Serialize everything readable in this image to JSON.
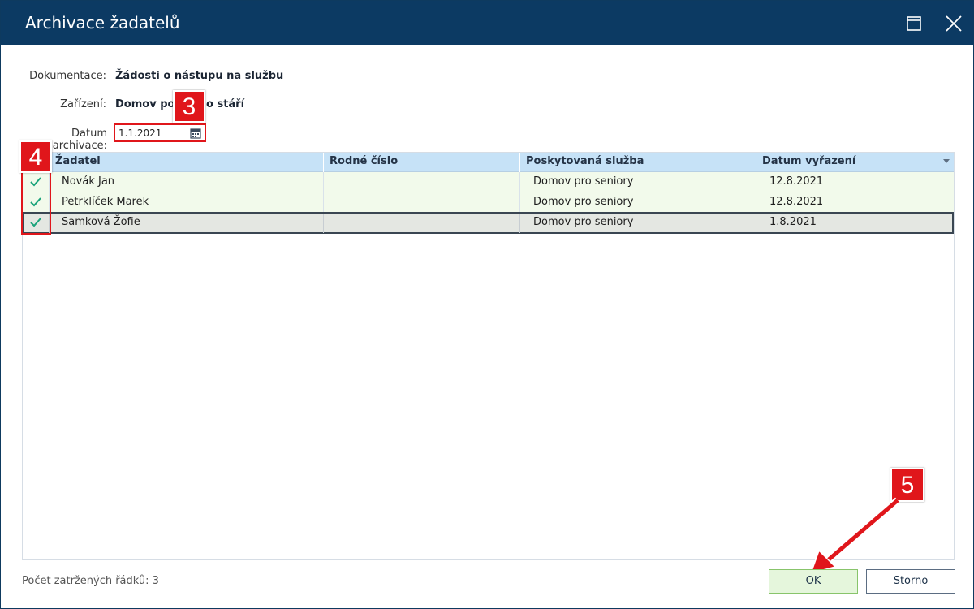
{
  "window": {
    "title": "Archivace žadatelů"
  },
  "form": {
    "documentation_label": "Dokumentace:",
    "documentation_value": "Žádosti o nástupu na službu",
    "facility_label": "Zařízení:",
    "facility_value": "Domov pok",
    "facility_value_rest": "o stáří",
    "archive_date_label": "Datum archivace:",
    "archive_date_value": "1.1.2021"
  },
  "callouts": {
    "three": "3",
    "four": "4",
    "five": "5"
  },
  "grid": {
    "columns": [
      "Žadatel",
      "Rodné číslo",
      "Poskytovaná služba",
      "Datum vyřazení"
    ],
    "rows": [
      {
        "checked": true,
        "applicant": "Novák Jan",
        "birth_number": "",
        "service": "Domov pro seniory",
        "removal_date": "12.8.2021"
      },
      {
        "checked": true,
        "applicant": "Petrklíček Marek",
        "birth_number": "",
        "service": "Domov pro seniory",
        "removal_date": "12.8.2021"
      },
      {
        "checked": true,
        "applicant": "Samková Žofie",
        "birth_number": "",
        "service": "Domov pro seniory",
        "removal_date": "1.8.2021"
      }
    ]
  },
  "footer": {
    "checked_count_text": "Počet zatržených řádků: 3",
    "ok_label": "OK",
    "cancel_label": "Storno"
  },
  "colors": {
    "titlebar": "#0c3a63",
    "header": "#c6e2f7",
    "row": "#f2faeb",
    "check": "#1aa37a",
    "annotation": "#e0161b",
    "ok_button": "#e5f6dc"
  }
}
